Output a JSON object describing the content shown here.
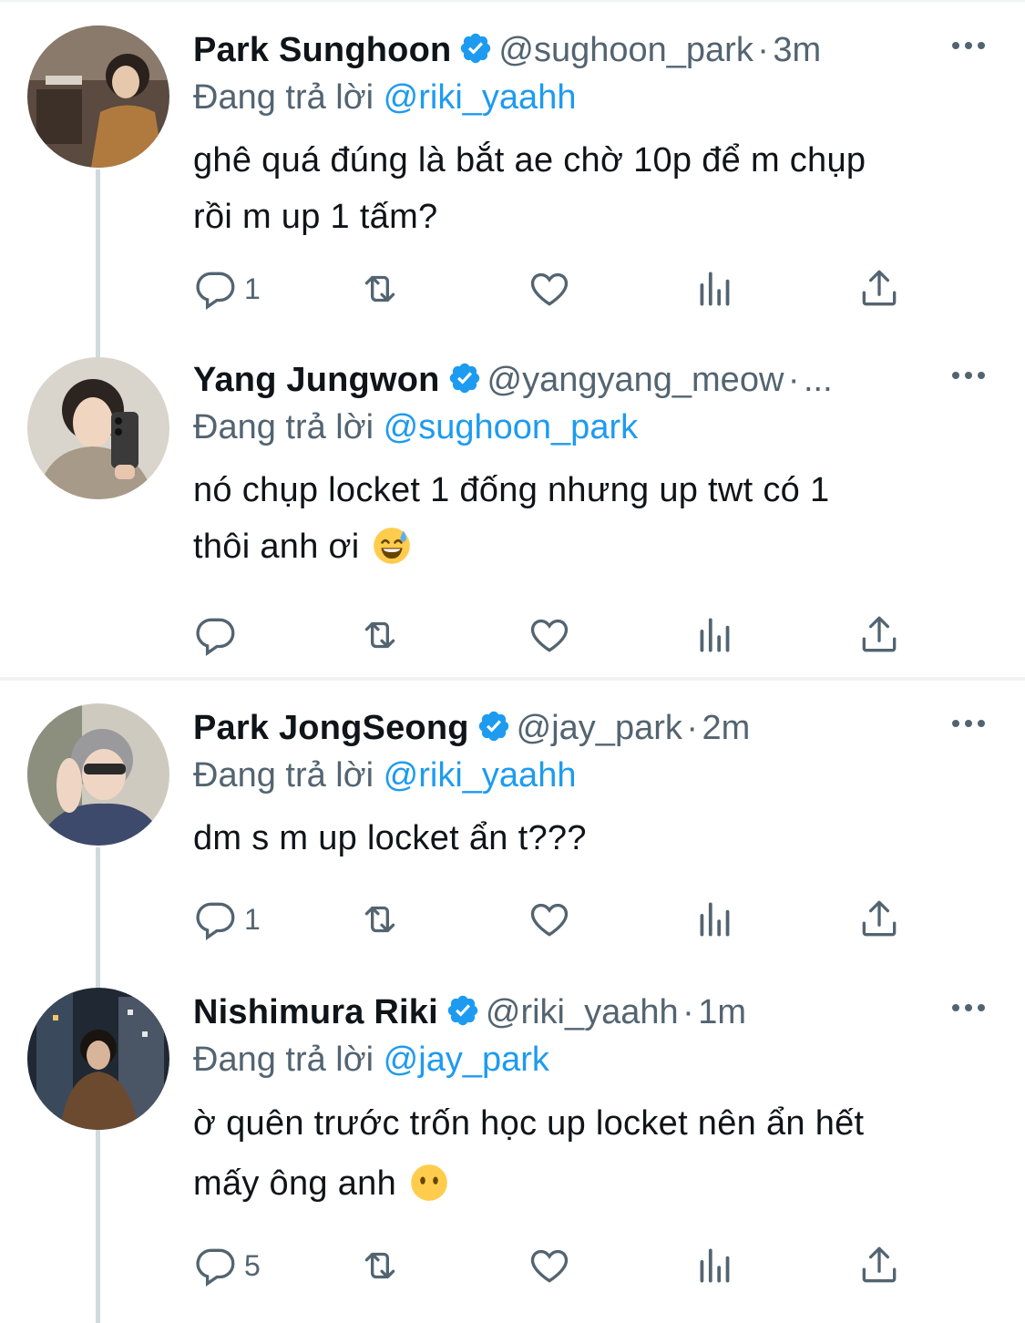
{
  "replying_prefix": "Đang trả lời",
  "tweets": [
    {
      "name": "Park Sunghoon",
      "handle": "@sughoon_park",
      "dot": "·",
      "time": "3m",
      "reply_to": "@riki_yaahh",
      "text_lines": [
        "ghê quá đúng là bắt ae chờ 10p để m chụp",
        "rồi m up 1 tấm?"
      ],
      "emoji": "",
      "reply_count": "1"
    },
    {
      "name": "Yang Jungwon",
      "handle": "@yangyang_meow",
      "dot": "·",
      "time": "...",
      "reply_to": "@sughoon_park",
      "text_lines": [
        "nó chụp locket 1 đống nhưng up twt có 1",
        "thôi anh ơi"
      ],
      "emoji": "sweat-smile-emoji",
      "reply_count": ""
    },
    {
      "name": "Park JongSeong",
      "handle": "@jay_park",
      "dot": "·",
      "time": "2m",
      "reply_to": "@riki_yaahh",
      "text_lines": [
        "dm s m up locket ẩn t???"
      ],
      "emoji": "",
      "reply_count": "1"
    },
    {
      "name": "Nishimura Riki",
      "handle": "@riki_yaahh",
      "dot": "·",
      "time": "1m",
      "reply_to": "@jay_park",
      "text_lines": [
        "ờ quên trước trốn học up locket nên ẩn hết",
        "mấy ông anh"
      ],
      "emoji": "no-mouth-emoji",
      "reply_count": "5"
    }
  ],
  "colors": {
    "accent": "#1d9bf0",
    "secondary_text": "#536471",
    "primary_text": "#0f1419",
    "thread_line": "#cfd9de"
  }
}
